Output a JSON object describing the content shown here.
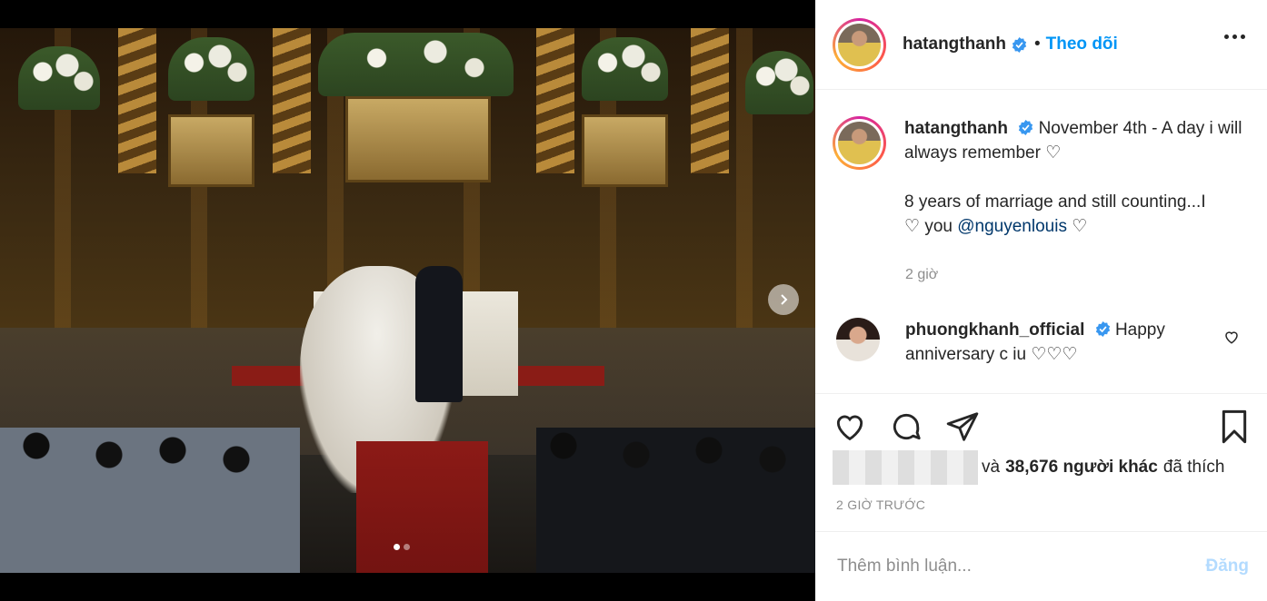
{
  "colors": {
    "accent": "#0095f6",
    "text": "#262626",
    "muted": "#8e8e8e",
    "verified": "#3897f0"
  },
  "header": {
    "username": "hatangthanh",
    "separator": "•",
    "follow_label": "Theo dõi",
    "more_icon": "more-horizontal-icon"
  },
  "caption": {
    "username": "hatangthanh",
    "line1": "November 4th - A day i will always remember",
    "line2_prefix": "8 years of marriage and still counting...I",
    "line2_you": "you",
    "mention": "@nguyenlouis",
    "time": "2 giờ"
  },
  "comment": {
    "username": "phuongkhanh_official",
    "text": "Happy anniversary c iu"
  },
  "media": {
    "carousel_total": 2,
    "carousel_active": 1,
    "next_icon": "chevron-right-icon"
  },
  "actions": {
    "like_icon": "heart-icon",
    "comment_icon": "comment-icon",
    "share_icon": "send-icon",
    "save_icon": "bookmark-icon"
  },
  "likes": {
    "prefix": "và",
    "count_label": "38,676 người khác",
    "suffix": "đã thích"
  },
  "posted_ago": "2 GIỜ TRƯỚC",
  "add_comment": {
    "placeholder": "Thêm bình luận...",
    "post_label": "Đăng"
  }
}
